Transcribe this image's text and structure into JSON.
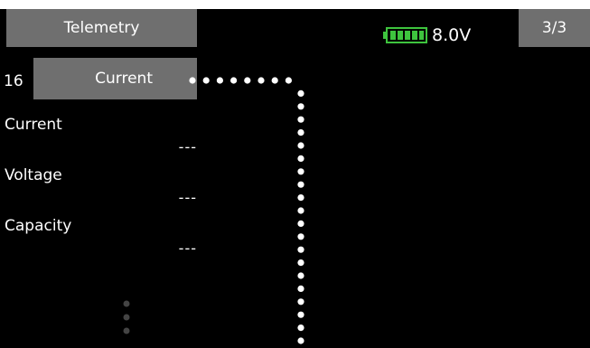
{
  "header": {
    "title": "Telemetry",
    "page": "3/3",
    "voltage": "8.0V",
    "battery_icon": "battery-full-icon",
    "battery_color": "#3ec43e"
  },
  "sensor": {
    "channel": "16",
    "name": "Current"
  },
  "readings": [
    {
      "label": "Current",
      "value": "---"
    },
    {
      "label": "Voltage",
      "value": "---"
    },
    {
      "label": "Capacity",
      "value": "---"
    }
  ],
  "colors": {
    "background": "#000000",
    "tab": "#6f6f6f",
    "text": "#ffffff"
  }
}
